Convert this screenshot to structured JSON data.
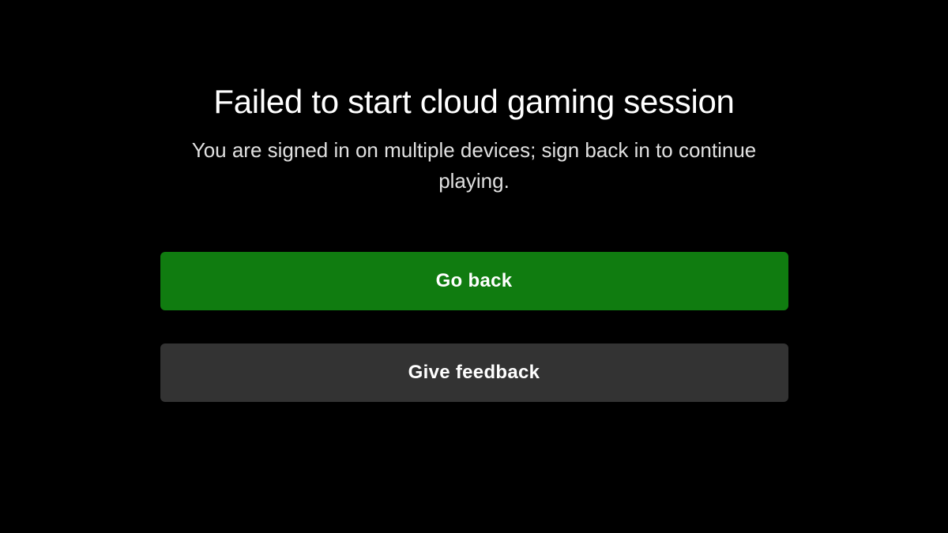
{
  "error": {
    "title": "Failed to start cloud gaming session",
    "message": "You are signed in on multiple devices; sign back in to continue playing."
  },
  "actions": {
    "primary_label": "Go back",
    "secondary_label": "Give feedback"
  }
}
